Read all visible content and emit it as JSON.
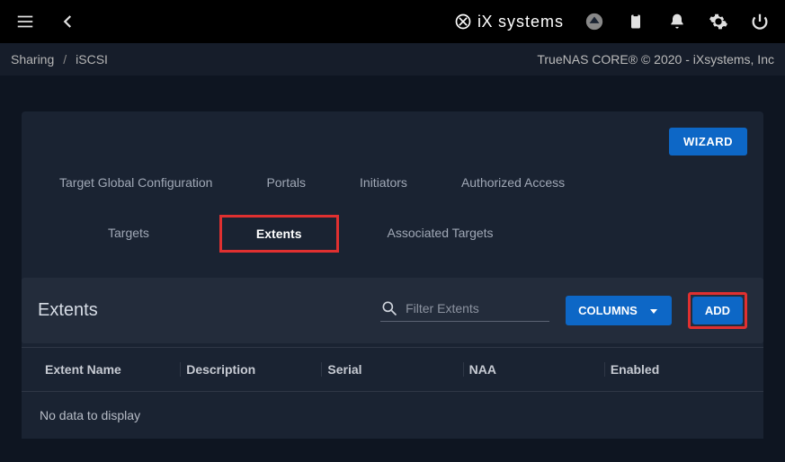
{
  "topbar": {
    "logo_ix": "iX",
    "logo_sys": "systems"
  },
  "breadcrumb": {
    "root": "Sharing",
    "sep": "/",
    "current": "iSCSI",
    "copyright": "TrueNAS CORE® © 2020 - iXsystems, Inc"
  },
  "buttons": {
    "wizard": "WIZARD",
    "columns": "COLUMNS",
    "add": "ADD"
  },
  "tabs": {
    "row1": {
      "tgc": "Target Global Configuration",
      "portals": "Portals",
      "initiators": "Initiators",
      "auth": "Authorized Access"
    },
    "row2": {
      "targets": "Targets",
      "extents": "Extents",
      "assoc": "Associated Targets"
    }
  },
  "section": {
    "title": "Extents",
    "search_placeholder": "Filter Extents"
  },
  "table": {
    "cols": {
      "name": "Extent Name",
      "desc": "Description",
      "serial": "Serial",
      "naa": "NAA",
      "enabled": "Enabled"
    },
    "empty": "No data to display"
  }
}
